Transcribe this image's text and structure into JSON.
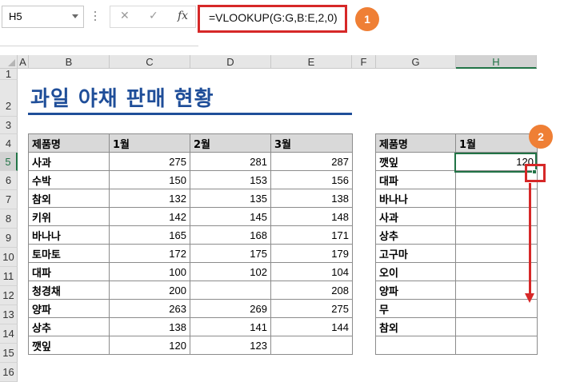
{
  "namebox": {
    "value": "H5"
  },
  "formula_bar": {
    "cancel_glyph": "✕",
    "enter_glyph": "✓",
    "fx_label": "fx",
    "formula": "=VLOOKUP(G:G,B:E,2,0)"
  },
  "annotations": {
    "badge1": "1",
    "badge2": "2"
  },
  "columns": [
    "A",
    "B",
    "C",
    "D",
    "E",
    "F",
    "G",
    "H"
  ],
  "rows": [
    "1",
    "2",
    "3",
    "4",
    "5",
    "6",
    "7",
    "8",
    "9",
    "10",
    "11",
    "12",
    "13",
    "14",
    "15",
    "16"
  ],
  "sheet_title": "과일 야채 판매 현황",
  "left_table": {
    "headers": [
      "제품명",
      "1월",
      "2월",
      "3월"
    ],
    "rows": [
      [
        "사과",
        "275",
        "281",
        "287"
      ],
      [
        "수박",
        "150",
        "153",
        "156"
      ],
      [
        "참외",
        "132",
        "135",
        "138"
      ],
      [
        "키위",
        "142",
        "145",
        "148"
      ],
      [
        "바나나",
        "165",
        "168",
        "171"
      ],
      [
        "토마토",
        "172",
        "175",
        "179"
      ],
      [
        "대파",
        "100",
        "102",
        "104"
      ],
      [
        "청경채",
        "200",
        "",
        "208"
      ],
      [
        "양파",
        "263",
        "269",
        "275"
      ],
      [
        "상추",
        "138",
        "141",
        "144"
      ],
      [
        "깻잎",
        "120",
        "123",
        ""
      ]
    ]
  },
  "right_table": {
    "headers": [
      "제품명",
      "1월"
    ],
    "rows": [
      [
        "깻잎",
        "120"
      ],
      [
        "대파",
        ""
      ],
      [
        "바나나",
        ""
      ],
      [
        "사과",
        ""
      ],
      [
        "상추",
        ""
      ],
      [
        "고구마",
        ""
      ],
      [
        "오이",
        ""
      ],
      [
        "양파",
        ""
      ],
      [
        "무",
        ""
      ],
      [
        "참외",
        ""
      ],
      [
        "",
        ""
      ]
    ]
  },
  "colors": {
    "accent_red": "#d62828",
    "badge_orange": "#ef7f35",
    "title_blue": "#1f4e99",
    "selection_green": "#217346"
  }
}
